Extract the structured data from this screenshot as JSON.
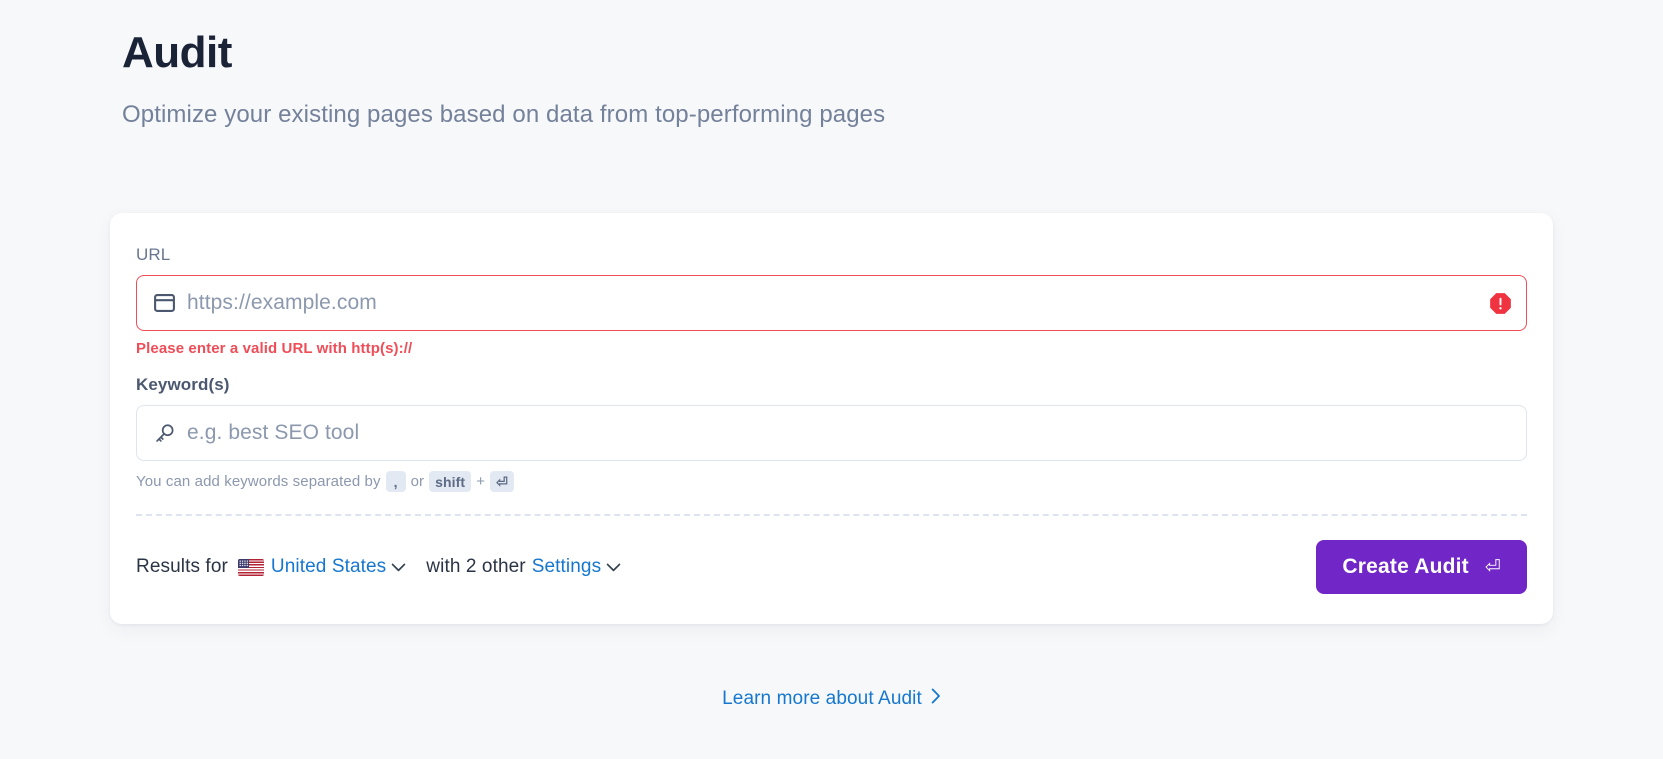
{
  "header": {
    "title": "Audit",
    "subtitle": "Optimize your existing pages based on data from top-performing pages"
  },
  "form": {
    "url_field": {
      "label": "URL",
      "placeholder": "https://example.com",
      "value": "",
      "icon": "browser-window-icon",
      "state": "error",
      "error_icon": "error-octagon-icon",
      "error_message": "Please enter a valid URL with http(s)://",
      "border_color": "#ef4e58"
    },
    "keyword_field": {
      "label": "Keyword(s)",
      "placeholder": "e.g. best SEO tool",
      "value": "",
      "icon": "key-icon",
      "helper_prefix": "You can add keywords separated by",
      "helper_key_comma": ",",
      "helper_middle": "or",
      "helper_key_shift": "shift",
      "helper_plus": "+",
      "helper_key_enter": "⏎"
    }
  },
  "footer": {
    "results_label": "Results for",
    "country_flag": "united-states-flag-icon",
    "country": "United States",
    "country_chevron": "chevron-down-icon",
    "with_other_label": "with 2 other",
    "settings_label": "Settings",
    "settings_chevron": "chevron-down-icon",
    "submit_label": "Create Audit",
    "submit_enter_glyph": "⏎",
    "submit_color": "#7127c8"
  },
  "learn_more": {
    "label": "Learn more about Audit",
    "chevron": "chevron-right-icon",
    "color": "#1677cf"
  }
}
